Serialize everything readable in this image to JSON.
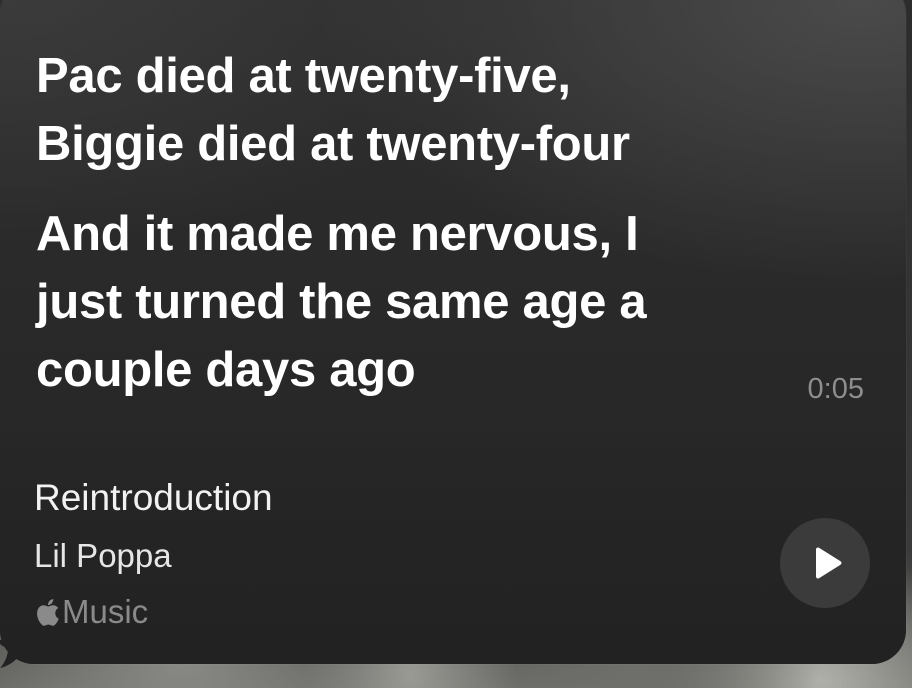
{
  "lyrics": {
    "line_1": "Pac died at twenty-five,\nBiggie died at twenty-four",
    "line_2": "And it made me nervous, I\njust turned the same age a\ncouple days ago",
    "timestamp": "0:05"
  },
  "track": {
    "title": "Reintroduction",
    "artist": "Lil Poppa",
    "service": "Music",
    "service_icon": "apple-logo-icon"
  },
  "controls": {
    "play_icon": "play-icon"
  },
  "colors": {
    "card_background": "#232323",
    "lyric_text": "#ffffff",
    "secondary_text": "#8a8a8a",
    "play_button_bg": "#3b3b3b"
  }
}
